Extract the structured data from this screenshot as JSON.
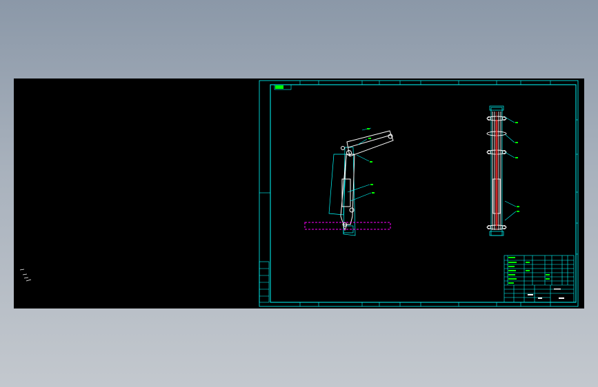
{
  "drawing": {
    "colors": {
      "canvas_bg": "#000000",
      "frame": "#00ffff",
      "geometry": "#ffffff",
      "outline": "#00ffff",
      "ground": "#ff00ff",
      "leader": "#00ffff",
      "text": "#00ff00",
      "title_text": "#ffffff",
      "hatch": "#ff0000"
    },
    "title_block_labels": {
      "drawing_name": "",
      "drawing_number": ""
    }
  }
}
